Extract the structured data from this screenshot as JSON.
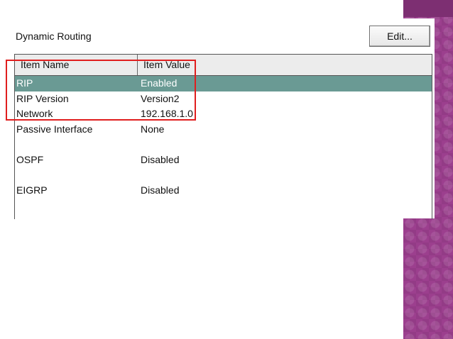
{
  "window": {
    "title": "Dynamic Routing",
    "edit_label": "Edit..."
  },
  "table": {
    "columns": [
      "Item Name",
      "Item Value"
    ],
    "rows": [
      {
        "name": "RIP",
        "value": "Enabled",
        "selected": true
      },
      {
        "name": "RIP Version",
        "value": "Version2",
        "selected": false
      },
      {
        "name": "Network",
        "value": "192.168.1.0",
        "selected": false
      },
      {
        "name": "Passive Interface",
        "value": "None",
        "selected": false
      },
      {
        "name": "OSPF",
        "value": "Disabled",
        "selected": false
      },
      {
        "name": "EIGRP",
        "value": "Disabled",
        "selected": false
      }
    ]
  },
  "colors": {
    "selected_row": "#6a9a94",
    "highlight_border": "#e01e1e",
    "accent_band": "#9c3f8e"
  }
}
